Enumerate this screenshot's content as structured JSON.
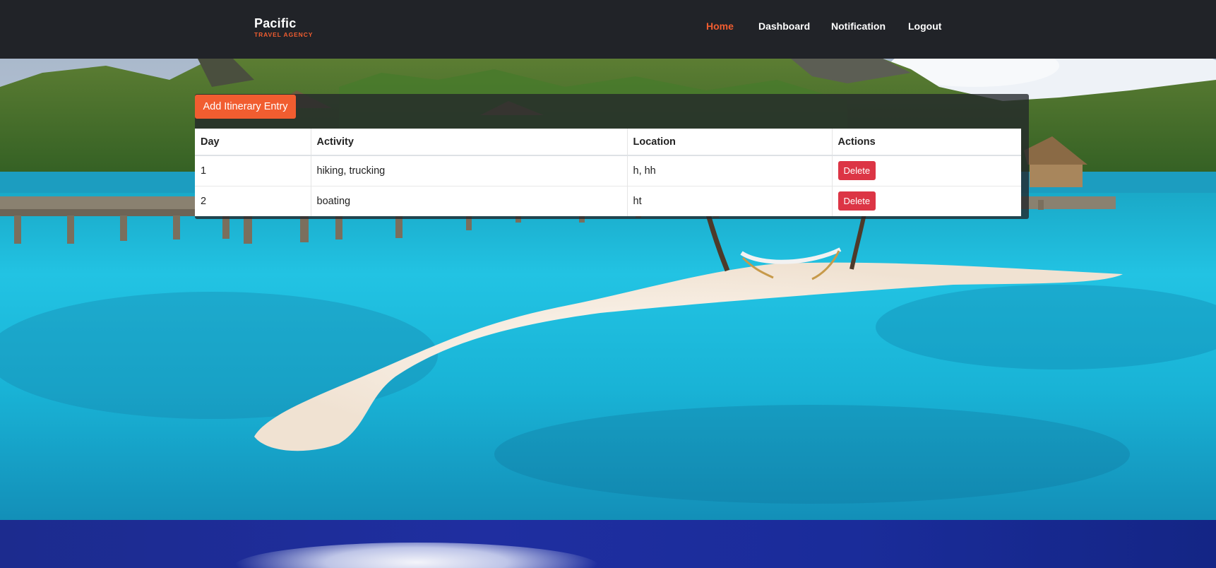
{
  "brand": {
    "name": "Pacific",
    "tagline": "TRAVEL AGENCY"
  },
  "nav": {
    "items": [
      {
        "label": "Home",
        "active": true
      },
      {
        "label": "Dashboard",
        "active": false
      },
      {
        "label": "Notification",
        "active": false
      },
      {
        "label": "Logout",
        "active": false
      }
    ]
  },
  "itinerary": {
    "add_button_label": "Add Itinerary Entry",
    "columns": [
      "Day",
      "Activity",
      "Location",
      "Actions"
    ],
    "rows": [
      {
        "day": "1",
        "activity": "hiking, trucking",
        "location": "h, hh",
        "action_label": "Delete"
      },
      {
        "day": "2",
        "activity": "boating",
        "location": "ht",
        "action_label": "Delete"
      }
    ]
  },
  "colors": {
    "accent": "#f15d30",
    "header_bg": "#212328",
    "delete": "#dc3545",
    "lagoon": "#19b6d8"
  },
  "background_image": "tropical-lagoon-with-overwater-bungalows-and-sandbar"
}
